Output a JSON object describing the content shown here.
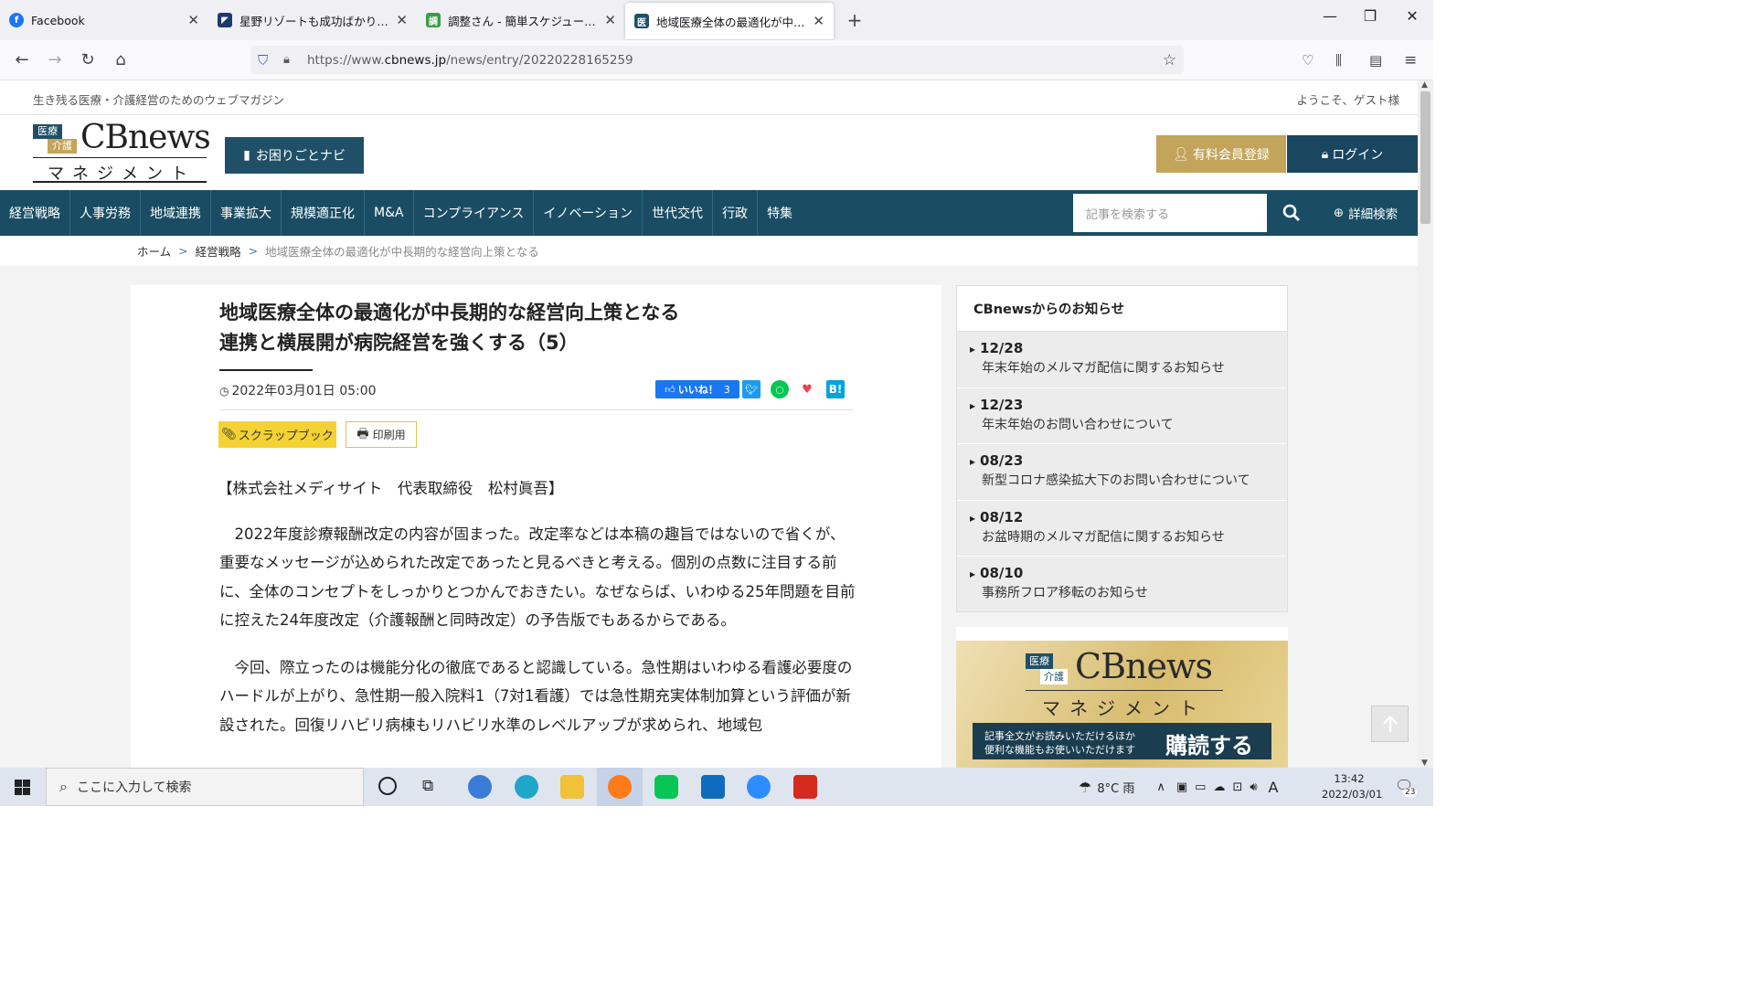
{
  "browser": {
    "tabs": [
      {
        "title": "Facebook",
        "icon": "facebook-icon",
        "color": "#1877f2"
      },
      {
        "title": "星野リゾートも成功ばかりじゃない？",
        "icon": "bookmark-logo-icon",
        "color": "#1a3a6b"
      },
      {
        "title": "調整さん - 簡単スケジュール調整、",
        "icon": "chouseisan-icon",
        "color": "#3a9e48"
      },
      {
        "title": "地域医療全体の最適化が中長期",
        "icon": "cbnews-favicon-icon",
        "color": "#1f5068"
      }
    ],
    "url_prefix": "https://www.",
    "url_domain": "cbnews.jp",
    "url_path": "/news/entry/20220228165259"
  },
  "site": {
    "tagline": "生き残る医療・介護経営のためのウェブマガジン",
    "welcome": "ようこそ、ゲスト様",
    "logo_text": "CBnews",
    "logo_sub": "マネジメント",
    "logo_badge1": "医療",
    "logo_badge2": "介護",
    "navi_button": "お困りごとナビ",
    "member_button": "有料会員登録",
    "login_button": "ログイン",
    "nav": [
      "経営戦略",
      "人事労務",
      "地域連携",
      "事業拡大",
      "規模適正化",
      "M&A",
      "コンプライアンス",
      "イノベーション",
      "世代交代",
      "行政",
      "特集"
    ],
    "search_placeholder": "記事を検索する",
    "adv_search": "詳細検索"
  },
  "breadcrumb": {
    "home": "ホーム",
    "category": "経営戦略",
    "current": "地域医療全体の最適化が中長期的な経営向上策となる"
  },
  "article": {
    "title_line1": "地域医療全体の最適化が中長期的な経営向上策となる",
    "title_line2": "連携と横展開が病院経営を強くする（5）",
    "date": "2022年03月01日 05:00",
    "like_label": "いいね！",
    "like_count": "3",
    "scrap_button": "スクラップブック",
    "print_button": "印刷用",
    "author": "【株式会社メディサイト　代表取締役　松村眞吾】",
    "para1": "　2022年度診療報酬改定の内容が固まった。改定率などは本稿の趣旨ではないので省くが、重要なメッセージが込められた改定であったと見るべきと考える。個別の点数に注目する前に、全体のコンセプトをしっかりとつかんでおきたい。なぜならば、いわゆる25年問題を目前に控えた24年度改定（介護報酬と同時改定）の予告版でもあるからである。",
    "para2": "　今回、際立ったのは機能分化の徹底であると認識している。急性期はいわゆる看護必要度のハードルが上がり、急性期一般入院料1（7対1看護）では急性期充実体制加算という評価が新設された。回復リハビリ病棟もリハビリ水準のレベルアップが求められ、地域包"
  },
  "notices": {
    "heading": "CBnewsからのお知らせ",
    "items": [
      {
        "date": "12/28",
        "text": "年末年始のメルマガ配信に関するお知らせ"
      },
      {
        "date": "12/23",
        "text": "年末年始のお問い合わせについて"
      },
      {
        "date": "08/23",
        "text": "新型コロナ感染拡大下のお問い合わせについて"
      },
      {
        "date": "08/12",
        "text": "お盆時期のメルマガ配信に関するお知らせ"
      },
      {
        "date": "08/10",
        "text": "事務所フロア移転のお知らせ"
      }
    ]
  },
  "banner": {
    "logo_text": "CBnews",
    "logo_sub": "マネジメント",
    "badge1": "医療",
    "badge2": "介護",
    "desc_line1": "記事全文がお読みいただけるほか",
    "desc_line2": "便利な機能もお使いいただけます",
    "cta": "購読する"
  },
  "taskbar": {
    "search_placeholder": "ここに入力して検索",
    "weather": "8°C 雨",
    "ime": "A",
    "time": "13:42",
    "date": "2022/03/01",
    "notifications": "23"
  },
  "colors": {
    "nav_bg": "#1a4d63",
    "gold": "#c2a45a",
    "login_bg": "#1b4660",
    "scrap_yellow": "#f4d233"
  }
}
